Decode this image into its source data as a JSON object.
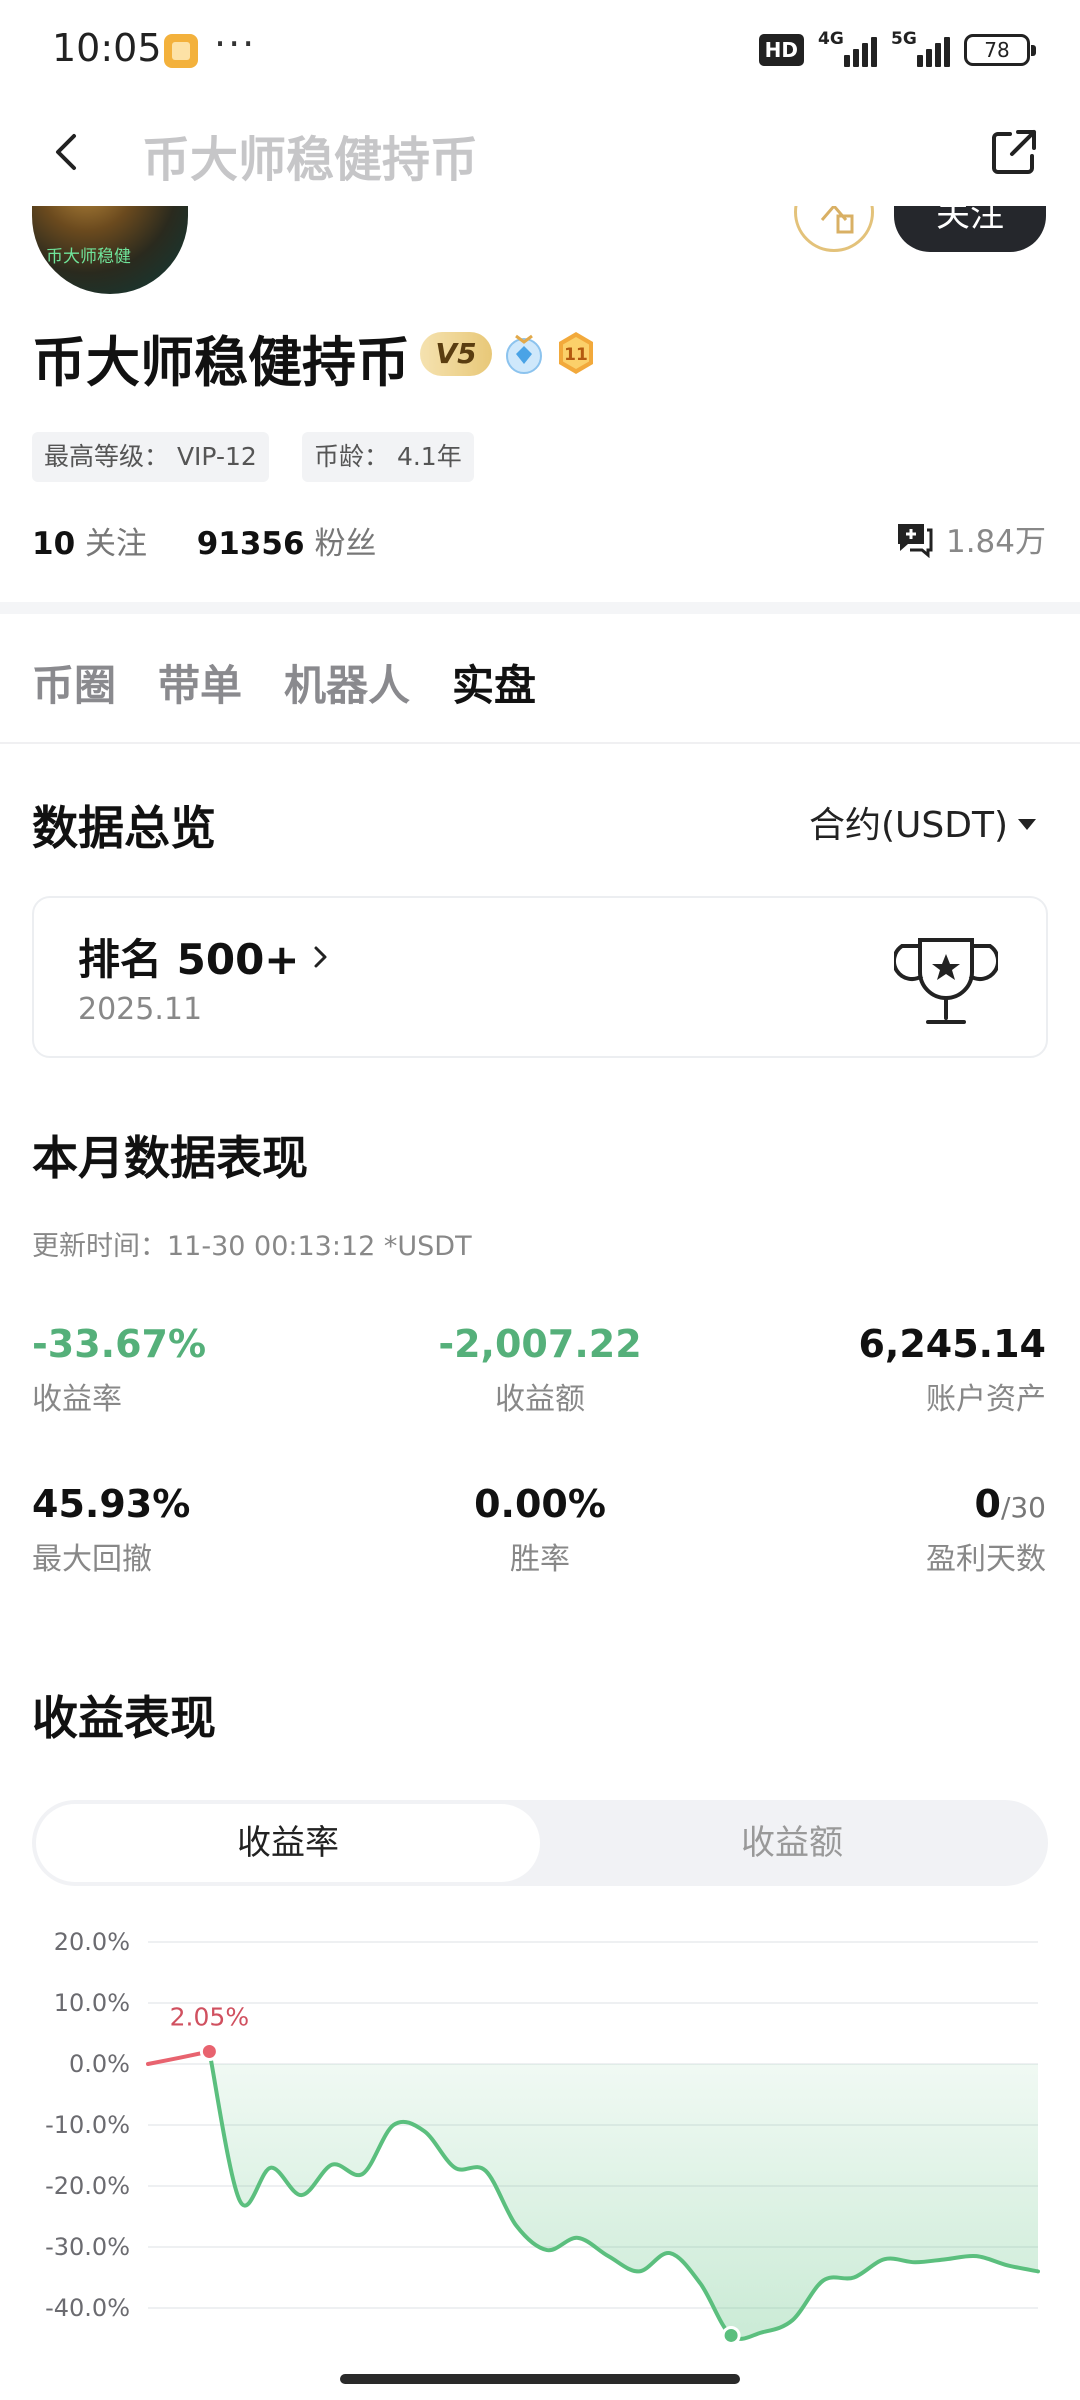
{
  "status_bar": {
    "time": "10:05",
    "dots": "···",
    "hd": "HD",
    "net1": "4G",
    "net2": "5G",
    "battery": "78"
  },
  "nav": {
    "title": "币大师稳健持币",
    "back_icon": "chevron-left-icon",
    "share_icon": "share-external-icon"
  },
  "profile": {
    "avatar_text": "币大师稳健",
    "follow_label": "关注",
    "name": "币大师稳健持币",
    "vip_badge": "V5",
    "level_badge": "11",
    "tags": [
      "最高等级： VIP-12",
      "币龄： 4.1年"
    ],
    "following_count": "10",
    "following_label": "关注",
    "followers_count": "91356",
    "followers_label": "粉丝",
    "messages": "1.84万"
  },
  "tabs": [
    "币圈",
    "带单",
    "机器人",
    "实盘"
  ],
  "active_tab": "实盘",
  "overview": {
    "title": "数据总览",
    "dropdown": "合约(USDT)",
    "rank_label": "排名 500+",
    "rank_date": "2025.11"
  },
  "monthly": {
    "title": "本月数据表现",
    "updated": "更新时间：11-30 00:13:12  *USDT",
    "metrics": [
      {
        "value": "-33.67%",
        "label": "收益率"
      },
      {
        "value": "-2,007.22",
        "label": "收益额"
      },
      {
        "value": "6,245.14",
        "label": "账户资产"
      },
      {
        "value": "45.93%",
        "label": "最大回撤"
      },
      {
        "value": "0.00%",
        "label": "胜率"
      },
      {
        "value": "0",
        "suffix": "/30",
        "label": "盈利天数"
      }
    ]
  },
  "performance": {
    "title": "收益表现",
    "seg_options": [
      "收益率",
      "收益额"
    ],
    "seg_active": "收益率"
  },
  "chart_data": {
    "type": "area",
    "y_unit": "%",
    "ylim": [
      -45,
      20
    ],
    "yticks": [
      "20.0%",
      "10.0%",
      "0.0%",
      "-10.0%",
      "-20.0%",
      "-30.0%",
      "-40.0%"
    ],
    "ytick_values": [
      20,
      10,
      0,
      -10,
      -20,
      -30,
      -40
    ],
    "x": [
      1,
      2,
      3,
      4,
      5,
      6,
      7,
      8,
      9,
      10,
      11,
      12,
      13,
      14,
      15,
      16,
      17,
      18,
      19,
      20,
      21,
      22,
      23,
      24,
      25,
      26,
      27,
      28,
      29,
      30
    ],
    "values": [
      0.0,
      1.0,
      2.05,
      -22.5,
      -17.0,
      -21.5,
      -16.5,
      -18.0,
      -10.0,
      -11.0,
      -17.0,
      -17.5,
      -26.5,
      -30.5,
      -28.5,
      -31.5,
      -34.0,
      -31.0,
      -36.0,
      -44.5,
      -44.0,
      -42.0,
      -35.5,
      -35.0,
      -32.0,
      -32.5,
      -32.0,
      -31.5,
      -33.0,
      -34.0
    ],
    "max_label": "2.05%",
    "max_index": 2,
    "min_index": 19,
    "colors": {
      "up": "#e8636f",
      "down": "#5bbf7e",
      "fill": "#5bbf7e"
    }
  }
}
